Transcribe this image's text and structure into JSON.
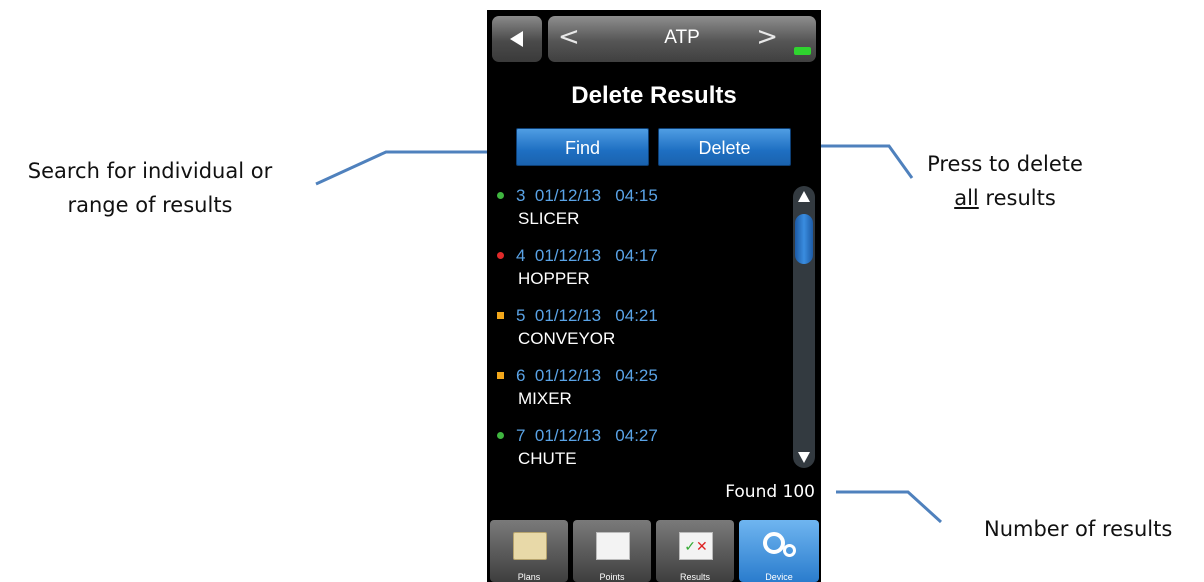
{
  "annotations": {
    "search": [
      "Search for individual or",
      "range of results"
    ],
    "delete": [
      "Press to delete",
      "all",
      " results"
    ],
    "count": "Number of results"
  },
  "device": {
    "screen_title": "ATP",
    "heading": "Delete Results",
    "find_label": "Find",
    "delete_label": "Delete",
    "results": [
      {
        "num": "3",
        "date": "01/12/13",
        "time": "04:15",
        "name": "SLICER",
        "status": "green"
      },
      {
        "num": "4",
        "date": "01/12/13",
        "time": "04:17",
        "name": "HOPPER",
        "status": "red"
      },
      {
        "num": "5",
        "date": "01/12/13",
        "time": "04:21",
        "name": "CONVEYOR",
        "status": "amber"
      },
      {
        "num": "6",
        "date": "01/12/13",
        "time": "04:25",
        "name": "MIXER",
        "status": "amber"
      },
      {
        "num": "7",
        "date": "01/12/13",
        "time": "04:27",
        "name": "CHUTE",
        "status": "green"
      }
    ],
    "found_text": "Found 100",
    "tabs": [
      "Plans",
      "Points",
      "Results",
      "Device"
    ]
  },
  "colors": {
    "green": "#3fb53f",
    "red": "#e02a2a",
    "amber": "#f2a71b",
    "link_blue": "#5aa3e6",
    "button_blue": "#1e6fc2"
  }
}
